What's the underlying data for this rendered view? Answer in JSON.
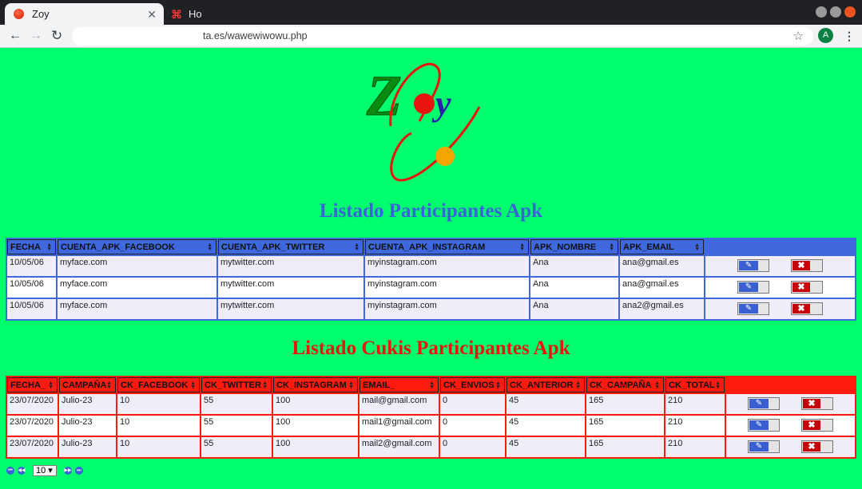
{
  "browser": {
    "active_tab_title": "Zoy",
    "inactive_tab_title": "Ho",
    "url": "ta.es/wawewiwowu.php",
    "avatar_letter": "A"
  },
  "logo": {
    "letters": "Zoy",
    "colors": {
      "z": "#0b8a10",
      "o": "#e8160e",
      "y": "#2a1fa8",
      "orbit": "#e8160e",
      "sun": "#f6a400"
    }
  },
  "page": {
    "title1": "Listado Participantes Apk",
    "title2": "Listado Cukis Participantes Apk",
    "title1_color": "#3b63d9",
    "title2_color": "#e8160e",
    "background": "#00ff6c"
  },
  "table1": {
    "headers": [
      "FECHA",
      "CUENTA_APK_FACEBOOK",
      "CUENTA_APK_TWITTER",
      "CUENTA_APK_INSTAGRAM",
      "APK_NOMBRE",
      "APK_EMAIL"
    ],
    "rows": [
      [
        "10/05/06",
        "myface.com",
        "mytwitter.com",
        "myinstagram.com",
        "Ana",
        "ana@gmail.es"
      ],
      [
        "10/05/06",
        "myface.com",
        "mytwitter.com",
        "myinstagram.com",
        "Ana",
        "ana@gmail.es"
      ],
      [
        "10/05/06",
        "myface.com",
        "mytwitter.com",
        "myinstagram.com",
        "Ana",
        "ana2@gmail.es"
      ]
    ]
  },
  "table2": {
    "headers": [
      "FECHA_",
      "CAMPAÑA",
      "CK_FACEBOOK",
      "CK_TWITTER",
      "CK_INSTAGRAM",
      "EMAIL_",
      "CK_ENVIOS",
      "CK_ANTERIOR",
      "CK_CAMPAÑA",
      "CK_TOTAL"
    ],
    "rows": [
      [
        "23/07/2020",
        "Julio-23",
        "10",
        "55",
        "100",
        "mail@gmail.com",
        "0",
        "45",
        "165",
        "210"
      ],
      [
        "23/07/2020",
        "Julio-23",
        "10",
        "55",
        "100",
        "mail1@gmail.com",
        "0",
        "45",
        "165",
        "210"
      ],
      [
        "23/07/2020",
        "Julio-23",
        "10",
        "55",
        "100",
        "mail2@gmail.com",
        "0",
        "45",
        "165",
        "210"
      ]
    ]
  },
  "pager": {
    "page_size": "10"
  }
}
